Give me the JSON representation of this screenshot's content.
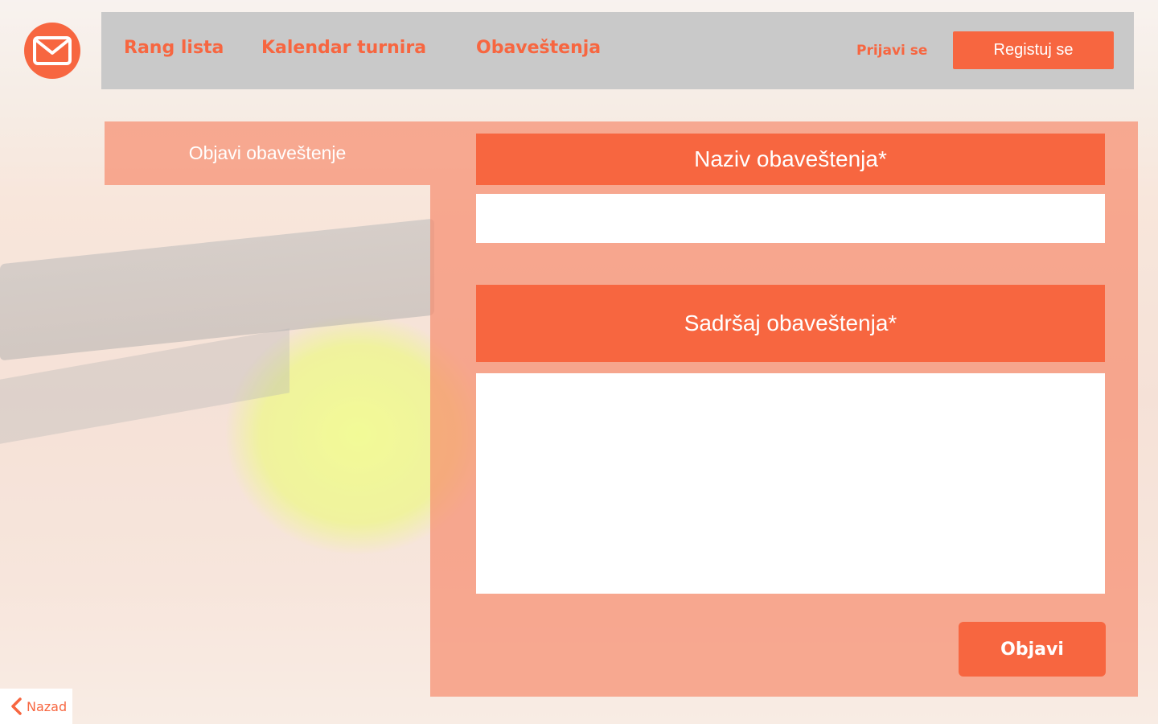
{
  "colors": {
    "accent": "#f76640",
    "navbar_bg": "#c9c9c9",
    "panel_bg": "#f78c6e"
  },
  "logo": {
    "icon": "envelope-icon"
  },
  "nav": {
    "links": [
      "Rang lista",
      "Kalendar turnira",
      "Obaveštenja"
    ],
    "login": "Prijavi se",
    "register": "Registuj se"
  },
  "sidebar": {
    "tab_label": "Objavi obaveštenje"
  },
  "form": {
    "title_label": "Naziv obaveštenja*",
    "title_value": "",
    "content_label": "Sadršaj obaveštenja*",
    "content_value": "",
    "submit_label": "Objavi"
  },
  "back": {
    "label": "Nazad",
    "icon": "chevron-left-icon"
  }
}
